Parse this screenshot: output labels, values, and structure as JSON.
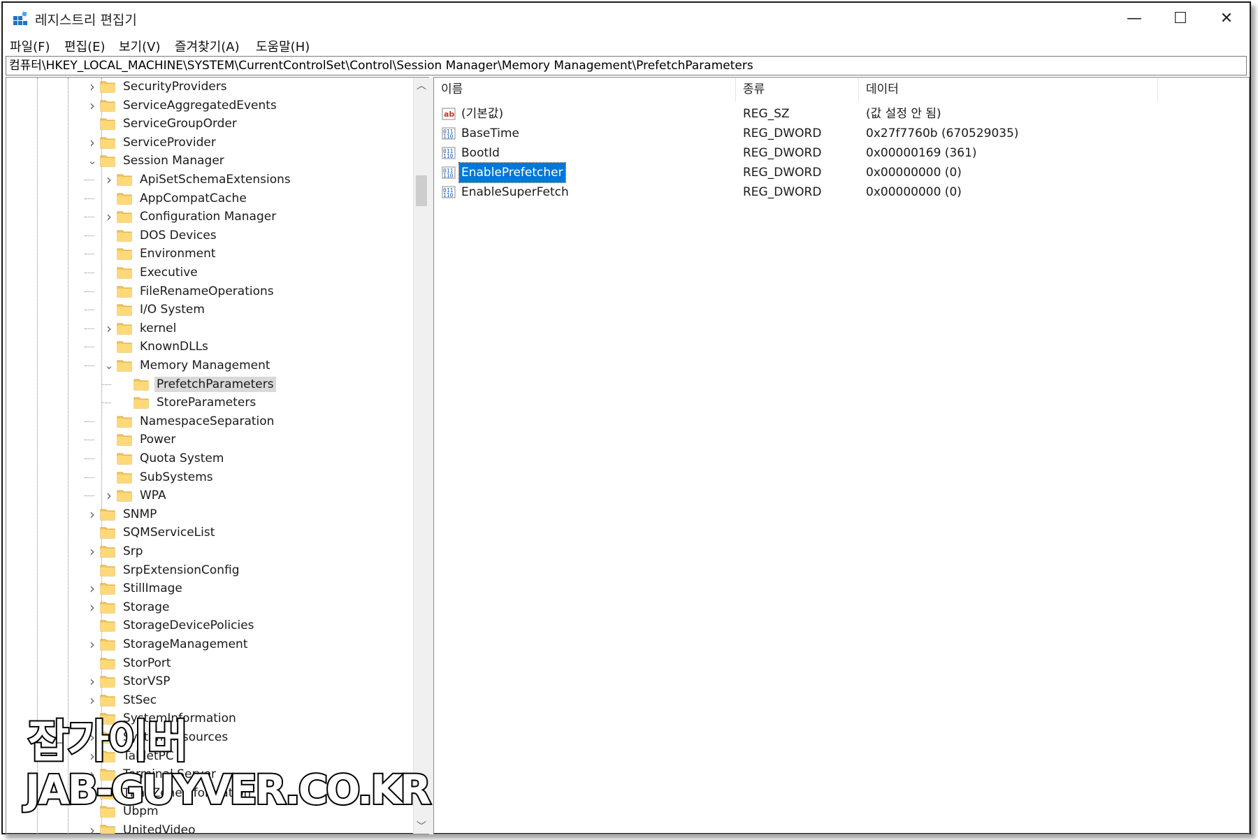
{
  "window": {
    "title": "레지스트리 편집기",
    "controls": {
      "minimize": "—",
      "maximize": "☐",
      "close": "✕"
    }
  },
  "menubar": {
    "items": [
      {
        "label": "파일(F)"
      },
      {
        "label": "편집(E)"
      },
      {
        "label": "보기(V)"
      },
      {
        "label": "즐겨찾기(A)"
      },
      {
        "label": "도움말(H)"
      }
    ]
  },
  "address": {
    "path": "컴퓨터\\HKEY_LOCAL_MACHINE\\SYSTEM\\CurrentControlSet\\Control\\Session Manager\\Memory Management\\PrefetchParameters"
  },
  "tree": {
    "nodes": [
      {
        "label": "SecurityProviders",
        "depth": 0,
        "toggle": "expand"
      },
      {
        "label": "ServiceAggregatedEvents",
        "depth": 0,
        "toggle": "expand"
      },
      {
        "label": "ServiceGroupOrder",
        "depth": 0,
        "toggle": ""
      },
      {
        "label": "ServiceProvider",
        "depth": 0,
        "toggle": "expand"
      },
      {
        "label": "Session Manager",
        "depth": 0,
        "toggle": "collapse"
      },
      {
        "label": "ApiSetSchemaExtensions",
        "depth": 1,
        "toggle": "expand"
      },
      {
        "label": "AppCompatCache",
        "depth": 1,
        "toggle": ""
      },
      {
        "label": "Configuration Manager",
        "depth": 1,
        "toggle": "expand"
      },
      {
        "label": "DOS Devices",
        "depth": 1,
        "toggle": ""
      },
      {
        "label": "Environment",
        "depth": 1,
        "toggle": ""
      },
      {
        "label": "Executive",
        "depth": 1,
        "toggle": ""
      },
      {
        "label": "FileRenameOperations",
        "depth": 1,
        "toggle": ""
      },
      {
        "label": "I/O System",
        "depth": 1,
        "toggle": ""
      },
      {
        "label": "kernel",
        "depth": 1,
        "toggle": "expand"
      },
      {
        "label": "KnownDLLs",
        "depth": 1,
        "toggle": ""
      },
      {
        "label": "Memory Management",
        "depth": 1,
        "toggle": "collapse"
      },
      {
        "label": "PrefetchParameters",
        "depth": 2,
        "toggle": "",
        "selected": true
      },
      {
        "label": "StoreParameters",
        "depth": 2,
        "toggle": ""
      },
      {
        "label": "NamespaceSeparation",
        "depth": 1,
        "toggle": ""
      },
      {
        "label": "Power",
        "depth": 1,
        "toggle": ""
      },
      {
        "label": "Quota System",
        "depth": 1,
        "toggle": ""
      },
      {
        "label": "SubSystems",
        "depth": 1,
        "toggle": ""
      },
      {
        "label": "WPA",
        "depth": 1,
        "toggle": "expand"
      },
      {
        "label": "SNMP",
        "depth": 0,
        "toggle": "expand"
      },
      {
        "label": "SQMServiceList",
        "depth": 0,
        "toggle": ""
      },
      {
        "label": "Srp",
        "depth": 0,
        "toggle": "expand"
      },
      {
        "label": "SrpExtensionConfig",
        "depth": 0,
        "toggle": ""
      },
      {
        "label": "StillImage",
        "depth": 0,
        "toggle": "expand"
      },
      {
        "label": "Storage",
        "depth": 0,
        "toggle": "expand"
      },
      {
        "label": "StorageDevicePolicies",
        "depth": 0,
        "toggle": ""
      },
      {
        "label": "StorageManagement",
        "depth": 0,
        "toggle": "expand"
      },
      {
        "label": "StorPort",
        "depth": 0,
        "toggle": ""
      },
      {
        "label": "StorVSP",
        "depth": 0,
        "toggle": "expand"
      },
      {
        "label": "StSec",
        "depth": 0,
        "toggle": "expand"
      },
      {
        "label": "SystemInformation",
        "depth": 0,
        "toggle": ""
      },
      {
        "label": "SystemResources",
        "depth": 0,
        "toggle": "expand"
      },
      {
        "label": "TabletPC",
        "depth": 0,
        "toggle": "expand"
      },
      {
        "label": "Terminal Server",
        "depth": 0,
        "toggle": "expand"
      },
      {
        "label": "TimeZoneInformation",
        "depth": 0,
        "toggle": ""
      },
      {
        "label": "Ubpm",
        "depth": 0,
        "toggle": ""
      },
      {
        "label": "UnitedVideo",
        "depth": 0,
        "toggle": "expand"
      }
    ]
  },
  "values": {
    "columns": {
      "name": "이름",
      "type": "종류",
      "data": "데이터"
    },
    "rows": [
      {
        "name": "(기본값)",
        "type": "REG_SZ",
        "data": "(값 설정 안 됨)",
        "icon": "string-value-icon"
      },
      {
        "name": "BaseTime",
        "type": "REG_DWORD",
        "data": "0x27f7760b (670529035)",
        "icon": "binary-value-icon"
      },
      {
        "name": "BootId",
        "type": "REG_DWORD",
        "data": "0x00000169 (361)",
        "icon": "binary-value-icon"
      },
      {
        "name": "EnablePrefetcher",
        "type": "REG_DWORD",
        "data": "0x00000000 (0)",
        "icon": "binary-value-icon",
        "selected": true
      },
      {
        "name": "EnableSuperFetch",
        "type": "REG_DWORD",
        "data": "0x00000000 (0)",
        "icon": "binary-value-icon"
      }
    ]
  },
  "watermark": {
    "korean": "잡가이버",
    "domain": "JAB-GUYVER.CO.KR"
  },
  "colors": {
    "selection": "#0078d7",
    "tree_selection": "#d9d9d9",
    "folder": "#f6c85f"
  }
}
